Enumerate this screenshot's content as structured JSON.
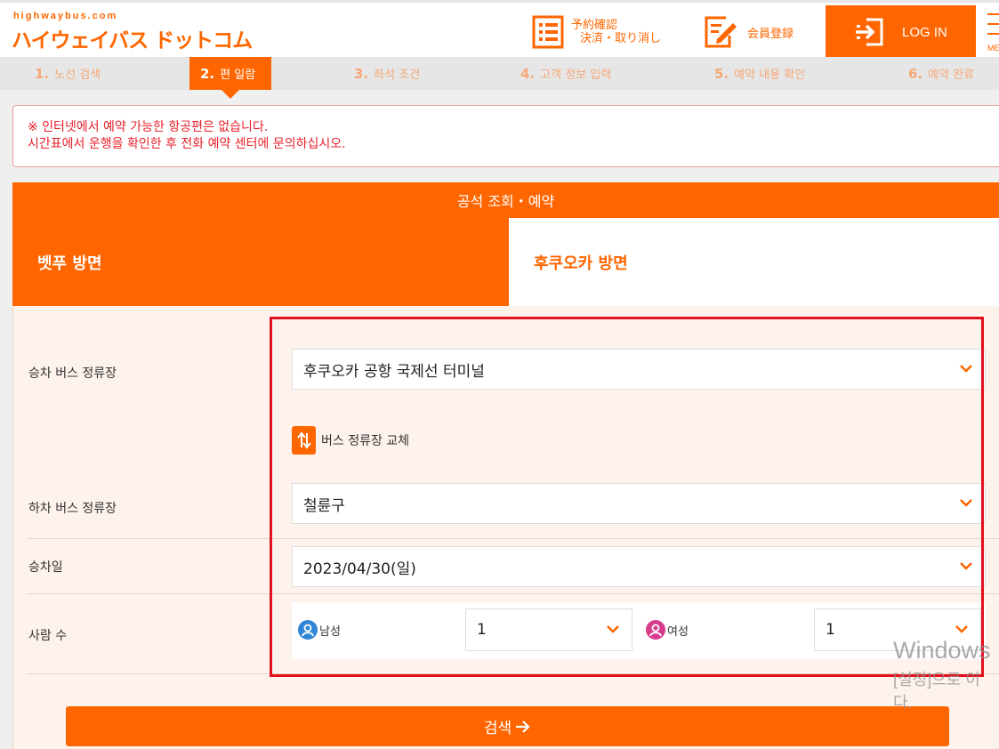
{
  "header": {
    "logo_small": "highwaybus.com",
    "logo_main": "ハイウェイバス ドットコム",
    "reserve_line1": "予約確認",
    "reserve_line2": "決済・取り消し",
    "register": "会員登録",
    "login": "LOG IN",
    "menu": "MENU"
  },
  "steps": [
    {
      "num": "1.",
      "label": "노선 검색"
    },
    {
      "num": "2.",
      "label": "편 일람"
    },
    {
      "num": "3.",
      "label": "좌석 조건"
    },
    {
      "num": "4.",
      "label": "고객 정보 입력"
    },
    {
      "num": "5.",
      "label": "예약 내용 확인"
    },
    {
      "num": "6.",
      "label": "예약 완료"
    }
  ],
  "active_step": 2,
  "notice": {
    "line1": "※ 인터넷에서 예약 가능한 항공편은 없습니다.",
    "line2": "시간표에서 운행을 확인한 후 전화 예약 센터에 문의하십시오."
  },
  "card": {
    "title": "공석 조회・예약",
    "tab_active": "벳푸 방면",
    "tab_inactive": "후쿠오카 방면"
  },
  "form": {
    "boarding_label": "승차 버스 정류장",
    "boarding_value": "후쿠오카 공항 국제선 터미널",
    "swap_label": "버스 정류장 교체",
    "alighting_label": "하차 버스 정류장",
    "alighting_value": "철륜구",
    "date_label": "승차일",
    "date_value": "2023/04/30(일)",
    "pax_label": "사람 수",
    "male_label": "남성",
    "male_value": "1",
    "female_label": "여성",
    "female_value": "1"
  },
  "search_button": "검색",
  "watermark": {
    "line1": "Windows",
    "line2": "[설정]으로 이",
    "line3": "다."
  },
  "colors": {
    "accent": "#ff6600",
    "alert": "#e8202a",
    "highlight": "#e3101e",
    "male": "#2f86d6",
    "female": "#d63c8c"
  }
}
